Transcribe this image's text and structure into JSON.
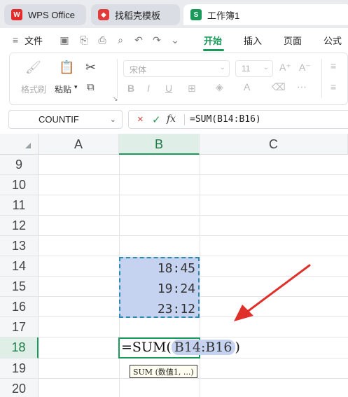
{
  "tabs": [
    {
      "label": "WPS Office",
      "icon": "wps-logo-icon"
    },
    {
      "label": "找稻壳模板",
      "icon": "docer-icon"
    },
    {
      "label": "工作簿1",
      "icon": "spreadsheet-icon"
    }
  ],
  "menu": {
    "file": "文件",
    "tabs": [
      "开始",
      "插入",
      "页面",
      "公式"
    ],
    "active_tab": "开始"
  },
  "ribbon": {
    "format_painter": "格式刷",
    "paste": "粘贴",
    "font_name": "宋体",
    "font_size": "11"
  },
  "formula_bar": {
    "name_box": "COUNTIF",
    "cancel": "×",
    "enter": "✓",
    "fx": "fx",
    "formula": "=SUM(B14:B16)"
  },
  "grid": {
    "columns": [
      "A",
      "B",
      "C"
    ],
    "selected_column": "B",
    "rows": [
      "9",
      "10",
      "11",
      "12",
      "13",
      "14",
      "15",
      "16",
      "17",
      "18",
      "19",
      "20"
    ],
    "selected_row": "18",
    "values": {
      "B14": "18:45",
      "B15": "19:24",
      "B16": "23:12"
    },
    "edit_prefix": "=SUM(",
    "edit_ref": "B14:B16",
    "edit_suffix": ")",
    "tooltip": "SUM (数值1, ...)"
  },
  "colors": {
    "accent": "#1a9a5a",
    "range_fill": "#c5d3f0",
    "arrow": "#e0302a"
  }
}
